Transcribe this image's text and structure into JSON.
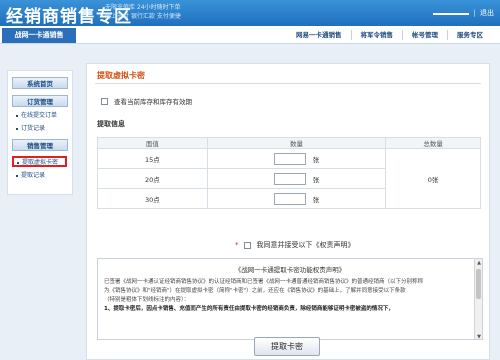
{
  "header": {
    "logo_text": "经销商销售专区",
    "slogan_lines": [
      "无限充值库  24小时随时下单",
      "网上支付  银行汇款  支付便捷"
    ],
    "logout_label": "退出"
  },
  "nav": {
    "active_tab": "战网一卡通销售",
    "links": [
      "网易一卡通销售",
      "将军令销售",
      "帐号管理",
      "服务专区"
    ]
  },
  "sidebar": {
    "home": "系统首页",
    "order_section": "订货管理",
    "order_items": [
      "在线提交订单",
      "订货记录"
    ],
    "sales_section": "销售管理",
    "sales_items": [
      "提取虚拟卡密",
      "提取记录"
    ]
  },
  "main": {
    "title": "提取虚拟卡密",
    "stock_checkbox_label": "查看当前库存和库存有效期",
    "section_label": "提取信息",
    "table": {
      "headers": [
        "面值",
        "数量",
        "总数量"
      ],
      "rows": [
        {
          "denomination": "15点",
          "unit": "张"
        },
        {
          "denomination": "20点",
          "unit": "张"
        },
        {
          "denomination": "30点",
          "unit": "张"
        }
      ],
      "total": "0张"
    },
    "agree_label": "我同意并接受以下《权责声明》",
    "disclaimer": {
      "title": "《战网一卡通提取卡密功能权责声明》",
      "lines": [
        "已签署《战网一卡通认证经销商销售协议》的认证经销商和已签署《战网一卡通普通经销商销售协议》的普通经销商（以下分别称称",
        "为《销售协议》和\"经销商\"）在提取虚拟卡密（简称\"卡密\"）之前，还应在《销售协议》的基础上，了解并同意接受以下条款",
        "（特别是粗体下划线标注的内容）："
      ],
      "bold_line": "1、提取卡密后，因点卡销售、充值而产生的所有责任由提取卡密的经销商负责，除经销商能够证明卡密被盗的情况下，"
    },
    "submit_label": "提取卡密"
  }
}
